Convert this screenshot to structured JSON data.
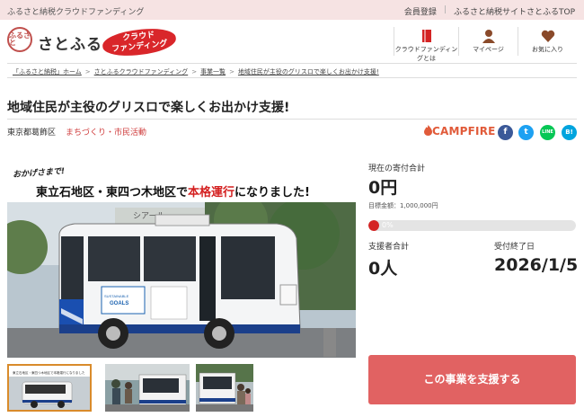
{
  "topbar": {
    "tagline": "ふるさと納税クラウドファンディング",
    "links": [
      "会員登録",
      "ふるさと納税サイトさとふるTOP"
    ]
  },
  "header": {
    "logo_mark": "ふるさと",
    "logo_text": "さとふる",
    "badge_line1": "クラウド",
    "badge_line2": "ファンディング",
    "nav": [
      "クラウドファンディングとは",
      "マイページ",
      "お気に入り"
    ]
  },
  "breadcrumb": [
    "「ふるさと納税」ホーム",
    "さとふるクラウドファンディング",
    "事業一覧",
    "地域住民が主役のグリスロで楽しくお出かけ支援!"
  ],
  "project": {
    "title": "地域住民が主役のグリスロで楽しくお出かけ支援!",
    "location": "東京都葛飾区",
    "category": "まちづくり・市民活動",
    "platform": "CAMPFIRE",
    "social": [
      "f",
      "t",
      "LINE",
      "B!"
    ]
  },
  "hero": {
    "caption1": "おかげさまで!",
    "caption2_a": "東立石地区・東四つ木地区で",
    "caption2_b": "本格運行",
    "caption2_c": "になりました!",
    "bus_sign": "シアール",
    "bus_goals": "SUSTAINABLE DEVELOPMENT GOALS",
    "stop_sign": "お",
    "thumb1_text": "東立石地区・東四つ木地区で本格運行になりました"
  },
  "funding": {
    "current_label": "現在の寄付合計",
    "current_value": "0円",
    "target_text": "目標金額：1,000,000円",
    "progress_text": "0%",
    "progress": 0.0,
    "supporters_label": "支援者合計",
    "supporters_value": "0人",
    "deadline_label": "受付終了日",
    "deadline_value": "2026/1/5"
  },
  "cta": {
    "label": "この事業を支援する"
  },
  "colors": {
    "accent": "#d42424",
    "cta": "#e16262",
    "topbar": "#f6e3e3",
    "facebook": "#3b5998",
    "twitter": "#1da1f2",
    "line": "#06c755",
    "hatena": "#00a4de"
  }
}
